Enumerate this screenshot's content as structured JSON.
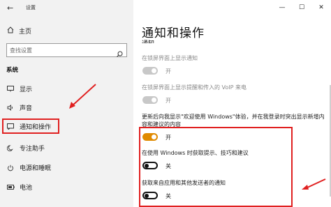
{
  "window": {
    "title": "设置",
    "back_icon": "back-arrow-icon",
    "controls": {
      "minimize": "—",
      "maximize": "☐",
      "close": "✕"
    }
  },
  "sidebar": {
    "home_label": "主页",
    "search_placeholder": "查找设置",
    "section_label": "系统",
    "items": [
      {
        "label": "显示",
        "icon": "display-icon"
      },
      {
        "label": "声音",
        "icon": "sound-icon"
      },
      {
        "label": "通知和操作",
        "icon": "notifications-icon",
        "active": true
      },
      {
        "label": "专注助手",
        "icon": "focus-assist-icon"
      },
      {
        "label": "电源和睡眠",
        "icon": "power-icon"
      },
      {
        "label": "电池",
        "icon": "battery-icon"
      }
    ]
  },
  "main": {
    "title": "通知和操作",
    "sub_heading": "通知",
    "settings": [
      {
        "label": "在锁屏界面上显示通知",
        "state": "开",
        "disabled": true
      },
      {
        "label": "在锁屏界面上显示提醒和传入的 VoIP 来电",
        "state": "开",
        "disabled": true
      },
      {
        "label": "更新后向我显示\"欢迎使用 Windows\"体验，并在我登录时突出显示新增内容和建议的内容",
        "state": "开",
        "disabled": false
      },
      {
        "label": "在使用 Windows 时获取提示、技巧和建议",
        "state": "关",
        "disabled": false
      },
      {
        "label": "获取来自应用和其他发送者的通知",
        "state": "关",
        "disabled": false
      }
    ]
  },
  "colors": {
    "accent": "#e08a00",
    "annotation_red": "#e02020",
    "sidebar_bg": "#f2f2f2"
  }
}
